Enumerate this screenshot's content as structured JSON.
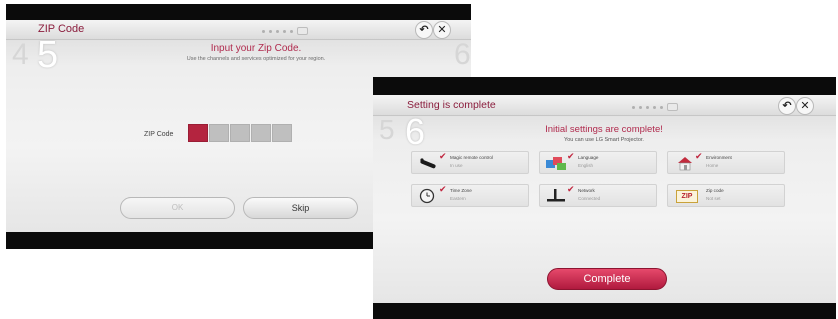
{
  "zip_screen": {
    "title": "ZIP Code",
    "step_prev": "4",
    "step_current": "5",
    "step_next": "6",
    "heading": "Input your Zip Code.",
    "subheading": "Use the channels and services optimized for your region.",
    "field_label": "ZIP Code",
    "digit_count": 5,
    "active_digit": 1,
    "ok_label": "OK",
    "skip_label": "Skip",
    "back_icon": "↶",
    "close_icon": "✕"
  },
  "complete_screen": {
    "title": "Setting is complete",
    "step_prev": "5",
    "step_current": "6",
    "heading": "Initial settings are complete!",
    "subheading": "You can use LG Smart Projector.",
    "items": [
      {
        "name": "Magic remote control",
        "value": "In use",
        "icon": "remote-icon"
      },
      {
        "name": "Language",
        "value": "English",
        "icon": "language-icon"
      },
      {
        "name": "Environment",
        "value": "Home",
        "icon": "home-icon"
      },
      {
        "name": "Time Zone",
        "value": "Eastern",
        "icon": "clock-icon"
      },
      {
        "name": "Network",
        "value": "Connected",
        "icon": "network-icon"
      },
      {
        "name": "Zip code",
        "value": "Not set",
        "icon": "zip-icon"
      }
    ],
    "zip_icon_text": "ZIP",
    "check_mark": "✔",
    "complete_label": "Complete",
    "back_icon": "↶",
    "close_icon": "✕"
  },
  "colors": {
    "accent": "#b02a4d",
    "button_accent": "#c42448",
    "active_zip_box": "#b4243f"
  }
}
